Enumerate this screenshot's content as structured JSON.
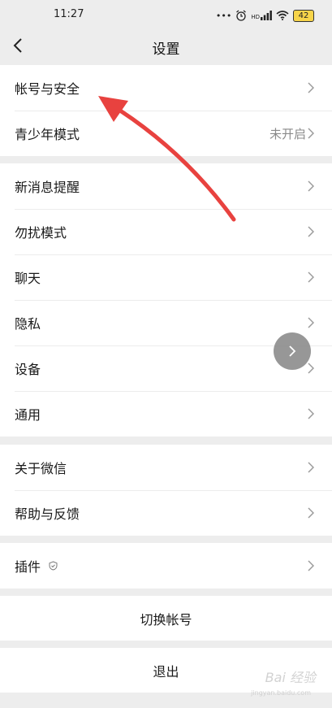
{
  "status_bar": {
    "time": "11:27",
    "hd": "HD",
    "battery": "42"
  },
  "nav": {
    "title": "设置"
  },
  "group1": [
    {
      "label": "帐号与安全",
      "value": ""
    },
    {
      "label": "青少年模式",
      "value": "未开启"
    }
  ],
  "group2": [
    {
      "label": "新消息提醒"
    },
    {
      "label": "勿扰模式"
    },
    {
      "label": "聊天"
    },
    {
      "label": "隐私"
    },
    {
      "label": "设备"
    },
    {
      "label": "通用"
    }
  ],
  "group3": [
    {
      "label": "关于微信"
    },
    {
      "label": "帮助与反馈"
    }
  ],
  "group4": [
    {
      "label": "插件"
    }
  ],
  "actions": {
    "switch_account": "切换帐号",
    "logout": "退出"
  },
  "watermark": {
    "brand": "Bai 经验",
    "url": "jingyan.baidu.com"
  },
  "colors": {
    "background": "#ededed",
    "annotation_arrow": "#e8423f"
  }
}
